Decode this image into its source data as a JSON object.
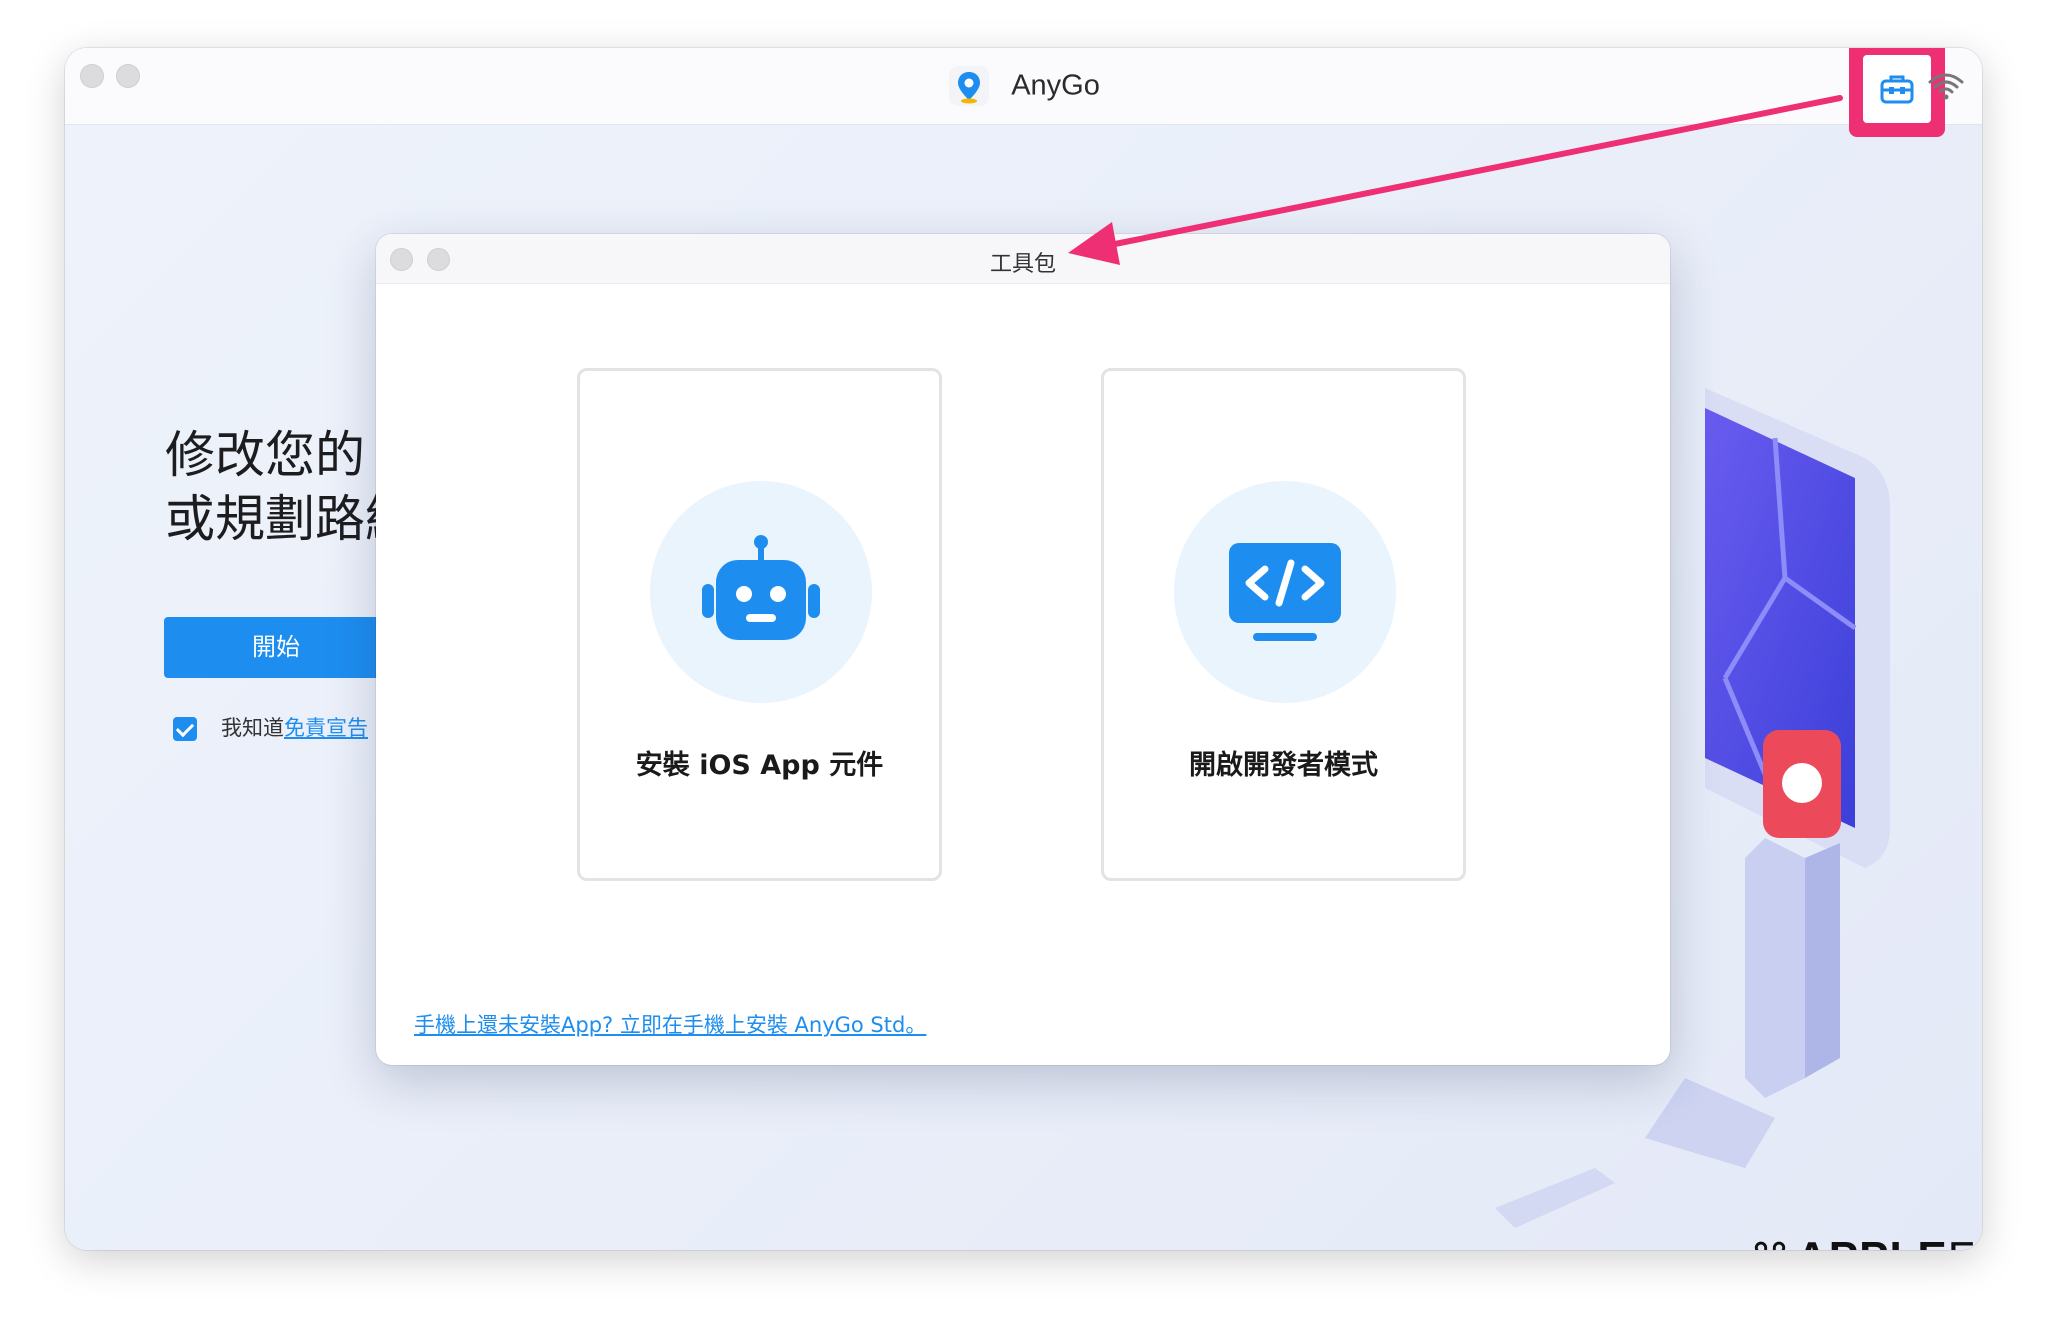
{
  "window": {
    "app_name": "AnyGo"
  },
  "main": {
    "headline_line1": "修改您的 G",
    "headline_line2": "或規劃路線",
    "start_label": "開始",
    "agree_prefix": "我知道",
    "agree_link": "免責宣告"
  },
  "dialog": {
    "title": "工具包",
    "cards": [
      {
        "label": "安裝 iOS App 元件",
        "icon": "robot-icon"
      },
      {
        "label": "開啟開發者模式",
        "icon": "developer-code-icon"
      }
    ],
    "install_link": "手機上還未安裝App? 立即在手機上安裝 AnyGo Std。"
  },
  "watermark": {
    "apple": "APPLE",
    "fans": "FANS"
  },
  "colors": {
    "accent": "#1d8ef0",
    "highlight": "#ee2f73"
  }
}
